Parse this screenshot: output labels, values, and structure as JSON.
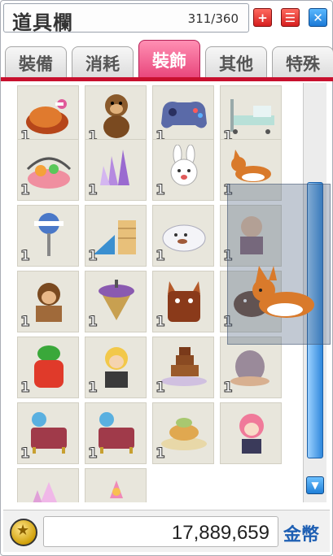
{
  "window": {
    "title": "道具欄",
    "slot_count": "311/360",
    "buttons": {
      "up_symbol": "+",
      "menu_symbol": "☰",
      "close_symbol": "✕"
    }
  },
  "tabs": [
    {
      "label": "裝備",
      "active": false
    },
    {
      "label": "消耗",
      "active": false
    },
    {
      "label": "裝飾",
      "active": true
    },
    {
      "label": "其他",
      "active": false
    },
    {
      "label": "特殊",
      "active": false
    }
  ],
  "items": [
    {
      "name": "roast-chicken-item",
      "qty": "1"
    },
    {
      "name": "monkey-plush-item",
      "qty": "1"
    },
    {
      "name": "game-controller-item",
      "qty": "1"
    },
    {
      "name": "hospital-bed-item",
      "qty": "1"
    },
    {
      "name": "fruit-basket-item",
      "qty": "1"
    },
    {
      "name": "purple-crystal-item",
      "qty": "1"
    },
    {
      "name": "bunny-plush-item",
      "qty": "1"
    },
    {
      "name": "corgi-item",
      "qty": "1"
    },
    {
      "name": "bus-stop-sign-item",
      "qty": "1"
    },
    {
      "name": "shark-slide-item",
      "qty": "1"
    },
    {
      "name": "white-seal-item",
      "qty": "1"
    },
    {
      "name": "bald-figure-item",
      "qty": "1"
    },
    {
      "name": "bearded-warrior-item",
      "qty": "1"
    },
    {
      "name": "spinning-top-item",
      "qty": "1"
    },
    {
      "name": "fox-doll-item",
      "qty": "1"
    },
    {
      "name": "dark-horse-item",
      "qty": "1"
    },
    {
      "name": "carrot-plant-item",
      "qty": "1"
    },
    {
      "name": "blond-boy-item",
      "qty": "1"
    },
    {
      "name": "chocolate-fountain-item",
      "qty": "1"
    },
    {
      "name": "bunny-egg-item",
      "qty": "1"
    },
    {
      "name": "blue-cat-chair-item",
      "qty": "1"
    },
    {
      "name": "blue-cat-chair-item-2",
      "qty": "1"
    },
    {
      "name": "sandwich-plate-item",
      "qty": "1"
    },
    {
      "name": "pink-hair-girl-item",
      "qty": ""
    },
    {
      "name": "pink-crystal-item",
      "qty": ""
    },
    {
      "name": "pink-statue-item",
      "qty": ""
    }
  ],
  "colors": {
    "active_tab": "#e8447a",
    "tab_underline": "#c8102e",
    "scroll_thumb": "#2f88dc",
    "meso_label": "#1e5fb3"
  },
  "currency": {
    "amount": "17,889,659",
    "label": "金幣",
    "icon": "meso-coin-icon"
  },
  "drag_preview": {
    "item": "corgi-item"
  }
}
